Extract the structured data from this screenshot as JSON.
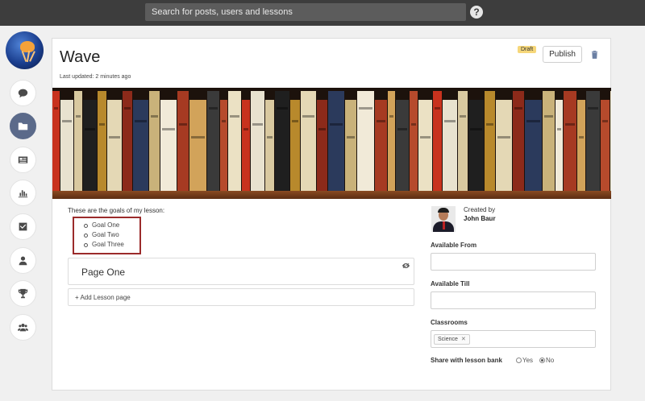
{
  "search": {
    "placeholder": "Search for posts, users and lessons"
  },
  "help": {
    "icon": "question-circle-icon",
    "glyph": "?"
  },
  "sidebar": {
    "items": [
      {
        "name": "comments",
        "icon": "comment-icon"
      },
      {
        "name": "lessons",
        "icon": "folder-icon",
        "active": true
      },
      {
        "name": "news",
        "icon": "newspaper-icon"
      },
      {
        "name": "reports",
        "icon": "bar-chart-icon"
      },
      {
        "name": "tasks",
        "icon": "checkbox-icon"
      },
      {
        "name": "profile",
        "icon": "user-icon"
      },
      {
        "name": "achievements",
        "icon": "trophy-icon"
      },
      {
        "name": "groups",
        "icon": "users-icon"
      }
    ]
  },
  "lesson": {
    "title": "Wave",
    "last_updated": "Last updated: 2 minutes ago",
    "status_badge": "Draft",
    "publish_label": "Publish",
    "goals_intro": "These are the goals of my lesson:",
    "goals": [
      "Goal One",
      "Goal Two",
      "Goal Three"
    ],
    "pages": [
      {
        "title": "Page One"
      }
    ],
    "add_page_label": "+ Add Lesson page"
  },
  "author": {
    "created_by_label": "Created by",
    "name": "John Baur"
  },
  "settings": {
    "available_from_label": "Available From",
    "available_from_value": "",
    "available_till_label": "Available Till",
    "available_till_value": "",
    "classrooms_label": "Classrooms",
    "classrooms": [
      "Science"
    ],
    "share_label": "Share with lesson bank",
    "share_options": [
      "Yes",
      "No"
    ],
    "share_selected": "No"
  },
  "colors": {
    "topbar": "#3d3d3d",
    "active_nav": "#5b6a8a",
    "draft_badge": "#f6d77a",
    "goals_highlight": "#9b2b2b"
  }
}
